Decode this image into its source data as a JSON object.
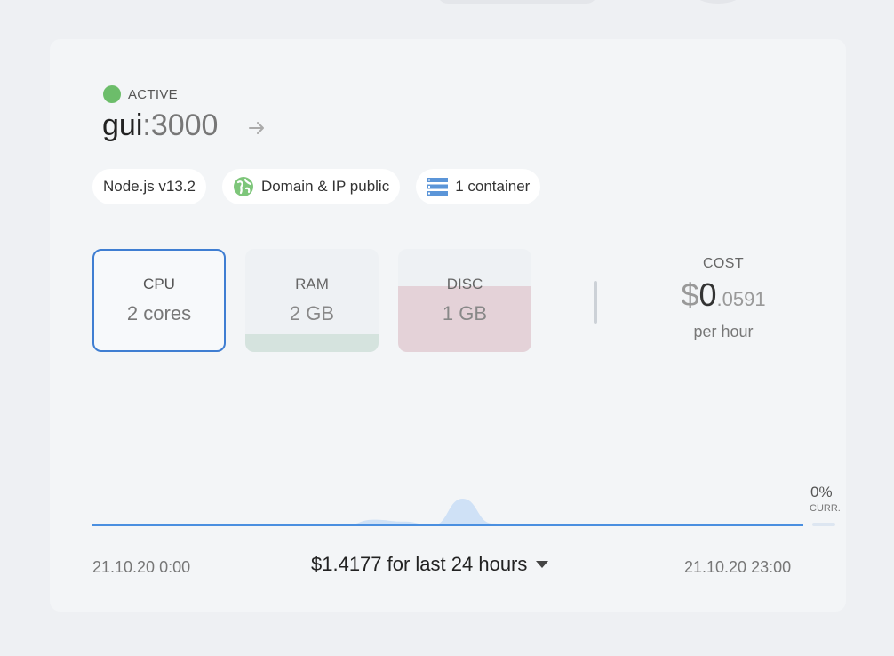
{
  "service": {
    "status": "ACTIVE",
    "status_color": "#6cbd6a",
    "name": "gui",
    "port": ":3000"
  },
  "chips": [
    {
      "label": "Node.js v13.2"
    },
    {
      "label": "Domain & IP public",
      "icon": "globe-icon"
    },
    {
      "label": "1 container",
      "icon": "server-stack-icon"
    }
  ],
  "metrics": [
    {
      "label": "CPU",
      "value": "2 cores",
      "usage": 0
    },
    {
      "label": "RAM",
      "value": "2 GB",
      "usage": 0.17,
      "fill_color": "#d5e3de"
    },
    {
      "label": "DISC",
      "value": "1 GB",
      "usage": 0.64,
      "fill_color": "#e4d2d8"
    }
  ],
  "cost": {
    "label": "COST",
    "currency": "$",
    "integer": "0",
    "decimal": ".0591",
    "unit": "per hour"
  },
  "chart_data": {
    "type": "area",
    "x_start_label": "21.10.20 0:00",
    "x_end_label": "21.10.20 23:00",
    "series": [
      {
        "values": [
          0.4,
          0.6,
          0.4,
          0,
          0,
          0,
          0,
          0,
          0,
          3,
          2,
          0,
          14,
          1,
          0,
          0,
          0,
          0,
          0,
          0,
          0,
          0,
          0,
          0
        ]
      }
    ],
    "current": {
      "value": "0%",
      "label": "CURR."
    },
    "line_color": "#4a8fe0",
    "fill_color": "#cfe1f6"
  },
  "summary": {
    "total": "$1.4177 for last 24 hours"
  }
}
